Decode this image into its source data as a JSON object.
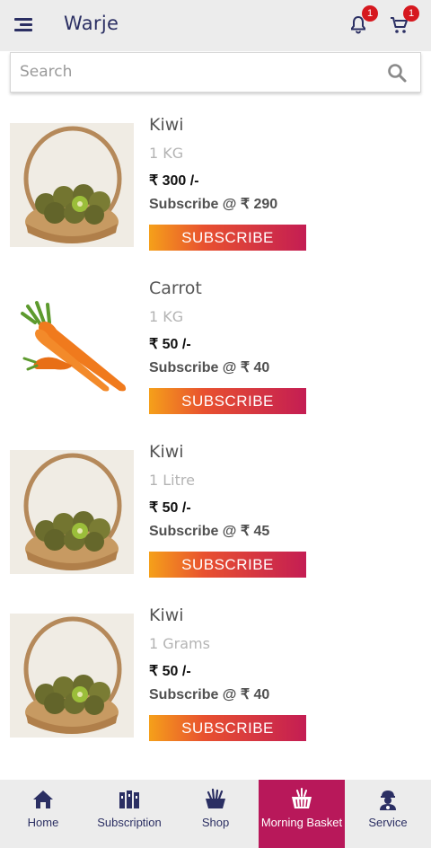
{
  "header": {
    "location": "Warje",
    "notification_count": "1",
    "cart_count": "1"
  },
  "search": {
    "placeholder": "Search"
  },
  "products": [
    {
      "name": "Kiwi",
      "quantity": "1 KG",
      "price": "₹ 300 /-",
      "subscribe_price": "Subscribe @ ₹ 290",
      "button": "SUBSCRIBE",
      "image": "kiwi-basket"
    },
    {
      "name": "Carrot",
      "quantity": "1 KG",
      "price": "₹ 50 /-",
      "subscribe_price": "Subscribe @ ₹ 40",
      "button": "SUBSCRIBE",
      "image": "carrots"
    },
    {
      "name": "Kiwi",
      "quantity": "1 Litre",
      "price": "₹ 50 /-",
      "subscribe_price": "Subscribe @ ₹ 45",
      "button": "SUBSCRIBE",
      "image": "kiwi-basket"
    },
    {
      "name": "Kiwi",
      "quantity": "1 Grams",
      "price": "₹ 50 /-",
      "subscribe_price": "Subscribe @ ₹ 40",
      "button": "SUBSCRIBE",
      "image": "kiwi-basket"
    }
  ],
  "bottom_nav": {
    "items": [
      {
        "label": "Home",
        "icon": "home-icon"
      },
      {
        "label": "Subscription",
        "icon": "subscription-icon"
      },
      {
        "label": "Shop",
        "icon": "shop-icon"
      },
      {
        "label": "Morning Basket",
        "icon": "basket-icon"
      },
      {
        "label": "Service",
        "icon": "service-icon"
      }
    ],
    "active": "Morning Basket"
  },
  "colors": {
    "primary": "#2b2f63",
    "accent": "#b8185a",
    "badge": "#d6181f",
    "button_gradient_start": "#f5a01a",
    "button_gradient_end": "#c41d53"
  }
}
